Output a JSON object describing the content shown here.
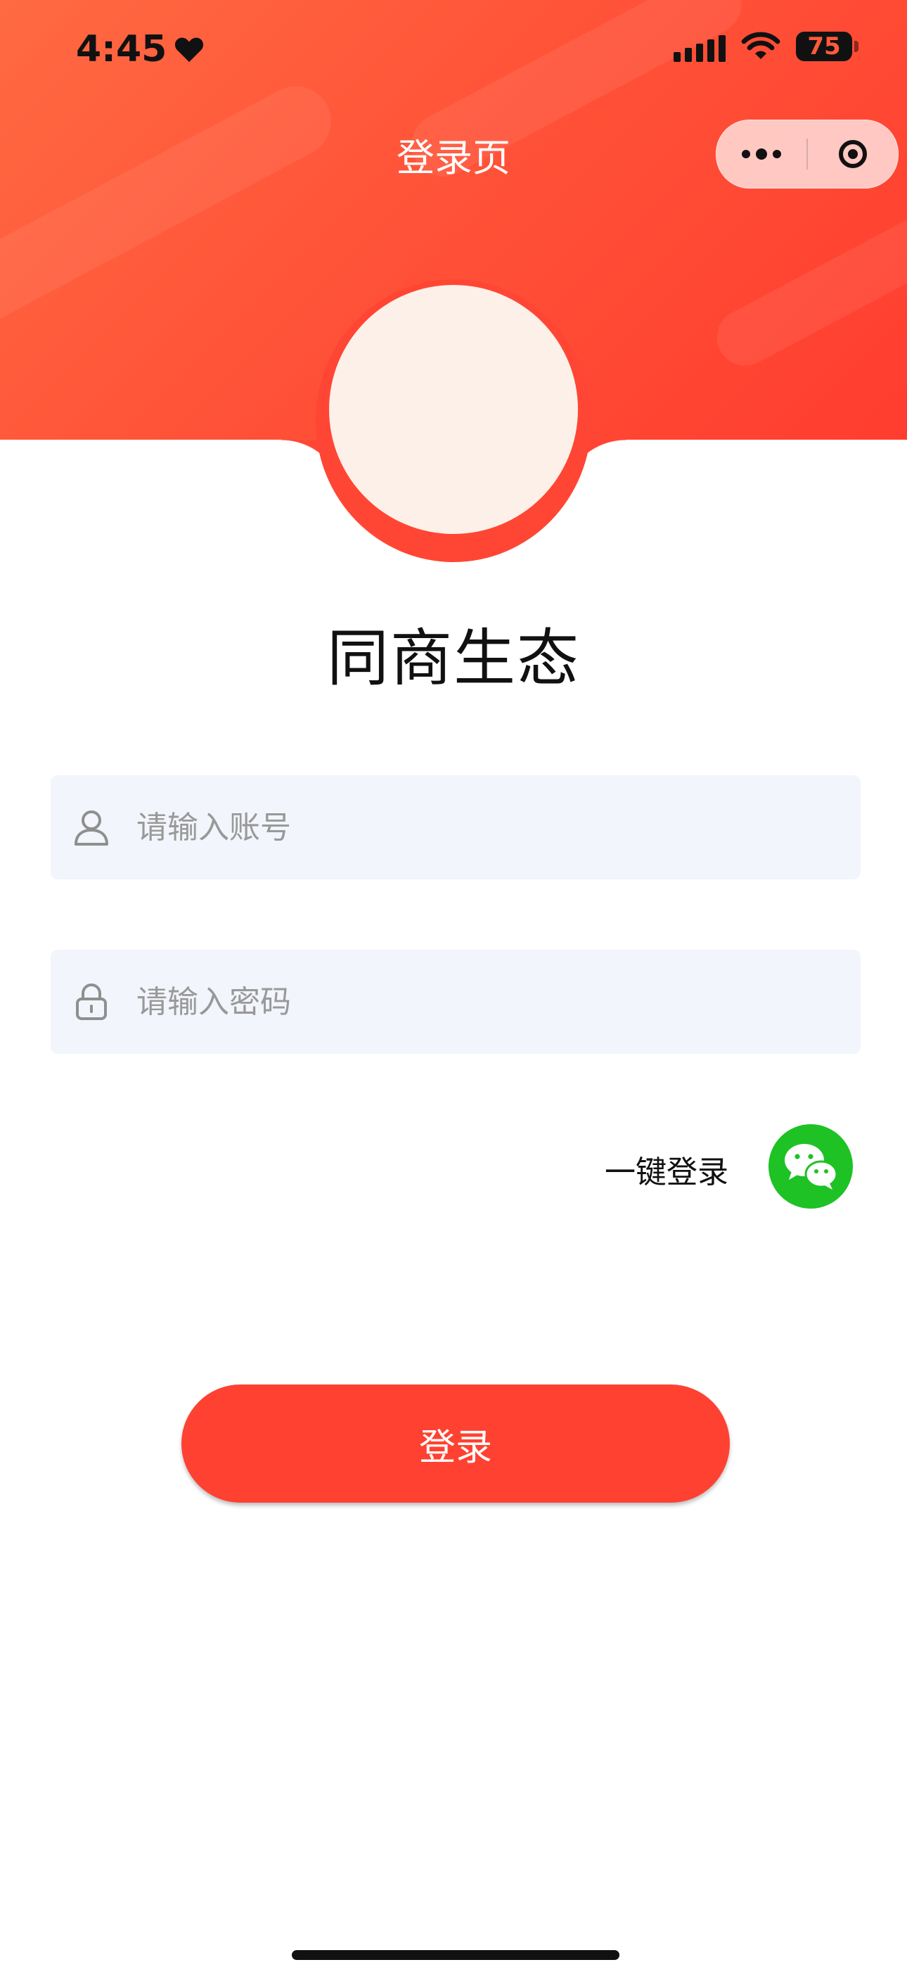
{
  "status_bar": {
    "time": "4:45",
    "battery": "75"
  },
  "nav": {
    "title": "登录页",
    "more_icon": "more-dots-icon",
    "close_icon": "target-icon"
  },
  "brand": {
    "name": "同商生态"
  },
  "form": {
    "account": {
      "placeholder": "请输入账号",
      "value": ""
    },
    "password": {
      "placeholder": "请输入密码",
      "value": ""
    }
  },
  "quick_login": {
    "label": "一键登录",
    "icon": "wechat-icon"
  },
  "login_button": {
    "label": "登录"
  },
  "colors": {
    "accent": "#ff4131",
    "header_start": "#ff6a42",
    "field_bg": "#f2f5fb",
    "wechat": "#1ec224"
  }
}
